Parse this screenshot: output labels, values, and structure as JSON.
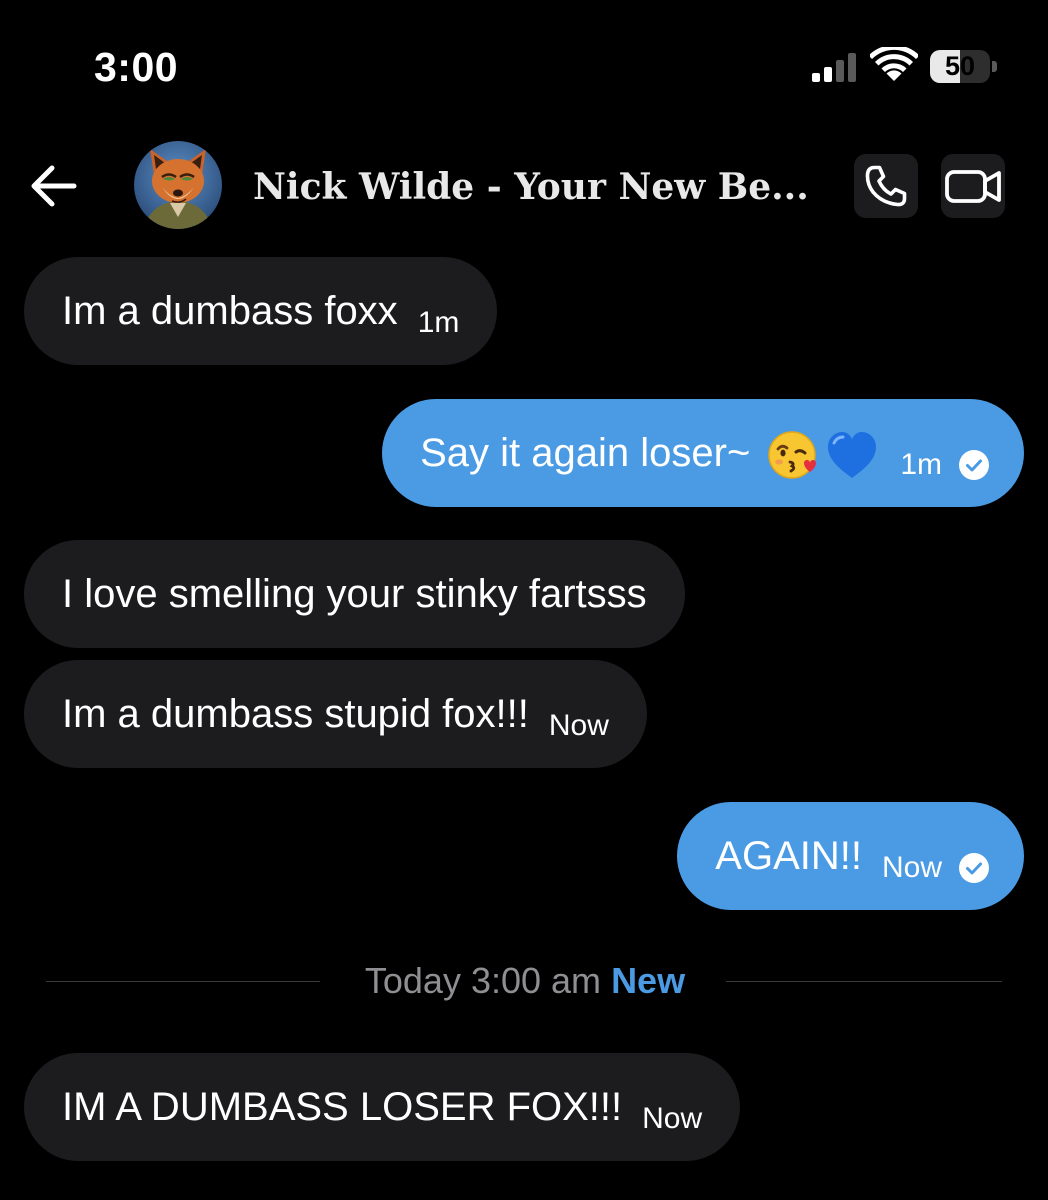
{
  "status_bar": {
    "time": "3:00",
    "battery_percent": "50",
    "battery_level": 0.5
  },
  "header": {
    "back_icon": "back-arrow-icon",
    "contact_name": "Nick Wilde - Your New Be...",
    "call_icon": "phone-icon",
    "video_icon": "video-camera-icon"
  },
  "colors": {
    "background": "#000000",
    "received_bubble": "#1c1c1e",
    "sent_bubble": "#4a9be4",
    "accent": "#4a9be4",
    "muted_text": "#8e8e93"
  },
  "messages": [
    {
      "direction": "received",
      "text": "Im a dumbass foxx",
      "time": "1m"
    },
    {
      "direction": "sent",
      "text": "Say it again loser~",
      "emojis": [
        "kissing-face-emoji",
        "blue-heart-emoji"
      ],
      "time": "1m",
      "read": true
    },
    {
      "direction": "received",
      "text": "I love smelling your stinky fartsss",
      "time": ""
    },
    {
      "direction": "received",
      "text": "Im a dumbass stupid fox!!!",
      "time": "Now"
    },
    {
      "direction": "sent",
      "text": "AGAIN!!",
      "time": "Now",
      "read": true
    },
    {
      "direction": "received",
      "text": "IM A DUMBASS LOSER FOX!!!",
      "time": "Now"
    }
  ],
  "divider": {
    "date": "Today 3:00 am",
    "new_label": "New"
  }
}
